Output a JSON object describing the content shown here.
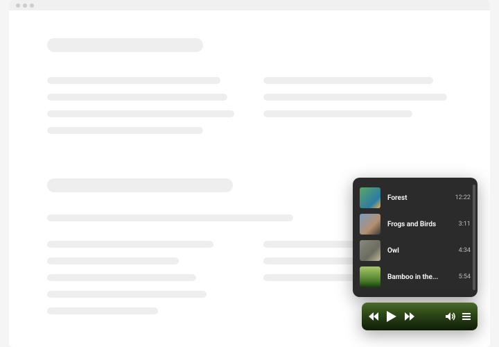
{
  "playlist": {
    "tracks": [
      {
        "title": "Forest",
        "duration": "12:22"
      },
      {
        "title": "Frogs and Birds",
        "duration": "3:11"
      },
      {
        "title": "Owl",
        "duration": "4:34"
      },
      {
        "title": "Bamboo in the...",
        "duration": "5:54"
      }
    ]
  },
  "player": {
    "icons": {
      "prev": "previous-icon",
      "play": "play-icon",
      "next": "next-icon",
      "volume": "volume-icon",
      "list": "list-icon"
    }
  },
  "colors": {
    "playlist_bg": "#2b2b2b",
    "player_bg_top": "#4a6a2a",
    "player_bg_bottom": "#0e1d08"
  }
}
